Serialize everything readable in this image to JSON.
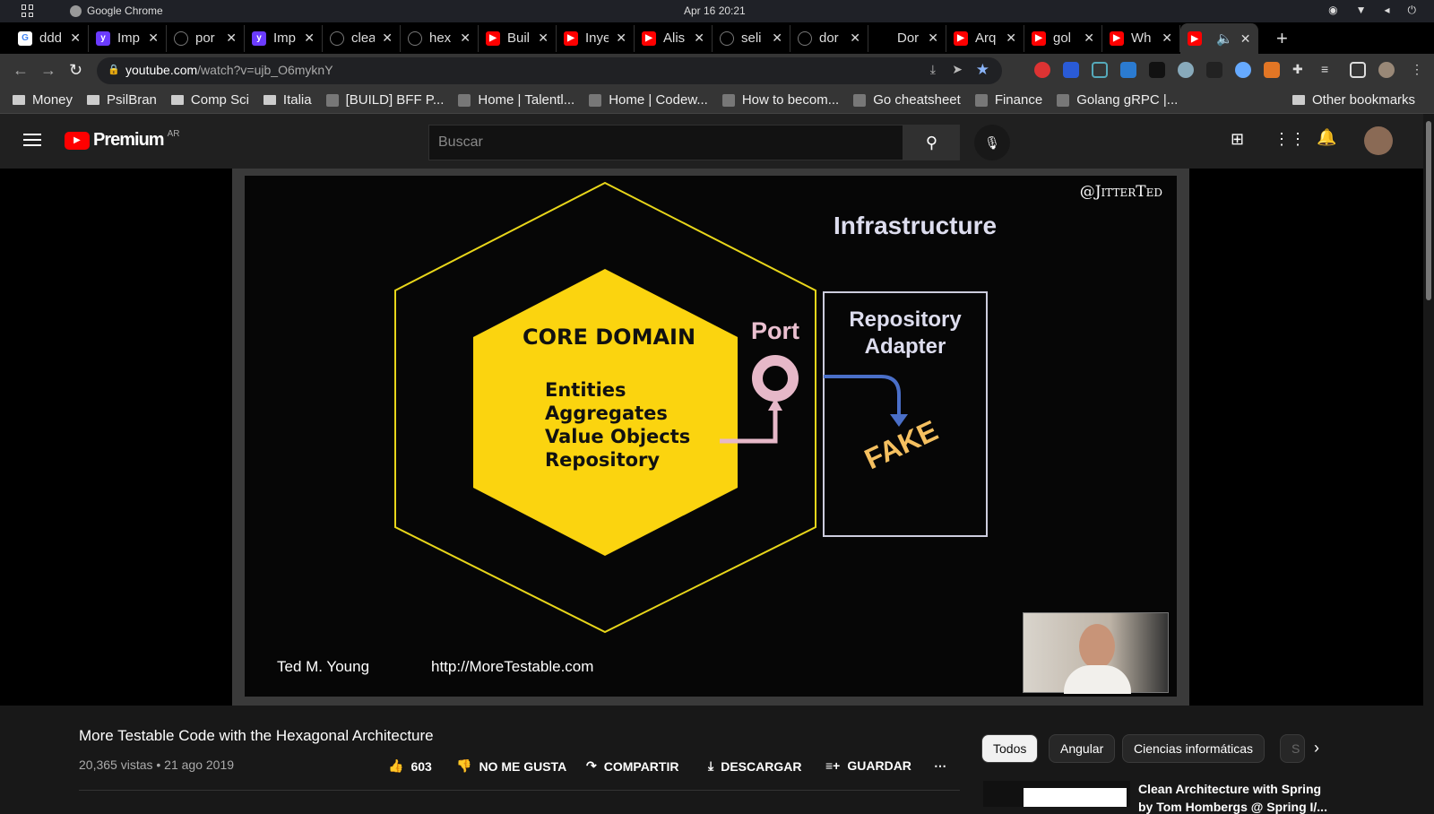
{
  "system": {
    "app": "Google Chrome",
    "clock": "Apr 16  20:21"
  },
  "tabs": [
    {
      "label": "ddd",
      "icon": "google-icon",
      "color": "#fff"
    },
    {
      "label": "Imp",
      "icon": "yahoo-icon",
      "color": "#6b3bff"
    },
    {
      "label": "por",
      "icon": "github-icon",
      "color": "#000"
    },
    {
      "label": "Imp",
      "icon": "yahoo-icon",
      "color": "#6b3bff"
    },
    {
      "label": "clea",
      "icon": "github-icon",
      "color": "#000"
    },
    {
      "label": "hex",
      "icon": "github-icon",
      "color": "#000"
    },
    {
      "label": "Buil",
      "icon": "youtube-icon",
      "color": "#f00"
    },
    {
      "label": "Inye",
      "icon": "youtube-icon",
      "color": "#f00"
    },
    {
      "label": "Alis",
      "icon": "youtube-icon",
      "color": "#f00"
    },
    {
      "label": "seli",
      "icon": "github-icon",
      "color": "#000"
    },
    {
      "label": "dor",
      "icon": "github-icon",
      "color": "#000"
    },
    {
      "label": "Dor",
      "icon": "hexagon-icon",
      "color": "#000"
    },
    {
      "label": "Arq",
      "icon": "youtube-icon",
      "color": "#f00"
    },
    {
      "label": "gol",
      "icon": "youtube-icon",
      "color": "#f00"
    },
    {
      "label": "Wh",
      "icon": "youtube-icon",
      "color": "#f00"
    },
    {
      "label": "",
      "icon": "youtube-icon",
      "color": "#f00"
    }
  ],
  "address": {
    "host": "youtube.com",
    "path": "/watch?v=ujb_O6myknY"
  },
  "bookmarks": [
    {
      "label": "Money",
      "icon": "folder"
    },
    {
      "label": "PsilBran",
      "icon": "folder"
    },
    {
      "label": "Comp Sci",
      "icon": "folder"
    },
    {
      "label": "Italia",
      "icon": "folder"
    },
    {
      "label": "[BUILD] BFF P...",
      "icon": "site"
    },
    {
      "label": "Home | Talentl...",
      "icon": "site"
    },
    {
      "label": "Home | Codew...",
      "icon": "site"
    },
    {
      "label": "How to becom...",
      "icon": "site"
    },
    {
      "label": "Go cheatsheet",
      "icon": "site"
    },
    {
      "label": "Finance",
      "icon": "site"
    },
    {
      "label": "Golang gRPC |...",
      "icon": "site"
    }
  ],
  "other_bookmarks": "Other bookmarks",
  "youtube": {
    "logo": "Premium",
    "region": "AR",
    "search_placeholder": "Buscar"
  },
  "slide": {
    "handle": "@JitterTed",
    "infra": "Infrastructure",
    "core": "CORE DOMAIN",
    "items": [
      "Entities",
      "Aggregates",
      "Value Objects",
      "Repository"
    ],
    "port": "Port",
    "adapter": [
      "Repository",
      "Adapter"
    ],
    "fake": "FAKE",
    "author": "Ted M. Young",
    "url": "http://MoreTestable.com"
  },
  "video": {
    "title": "More Testable Code with the Hexagonal Architecture",
    "meta": "20,365 vistas • 21 ago 2019",
    "likes": "603",
    "dislike": "NO ME GUSTA",
    "share": "COMPARTIR",
    "download": "DESCARGAR",
    "save": "GUARDAR"
  },
  "chips": [
    "Todos",
    "Angular",
    "Ciencias informáticas",
    "S"
  ],
  "recommended": {
    "title": "Clean Architecture with Spring",
    "subtitle": "by Tom Hombergs @ Spring I/..."
  }
}
